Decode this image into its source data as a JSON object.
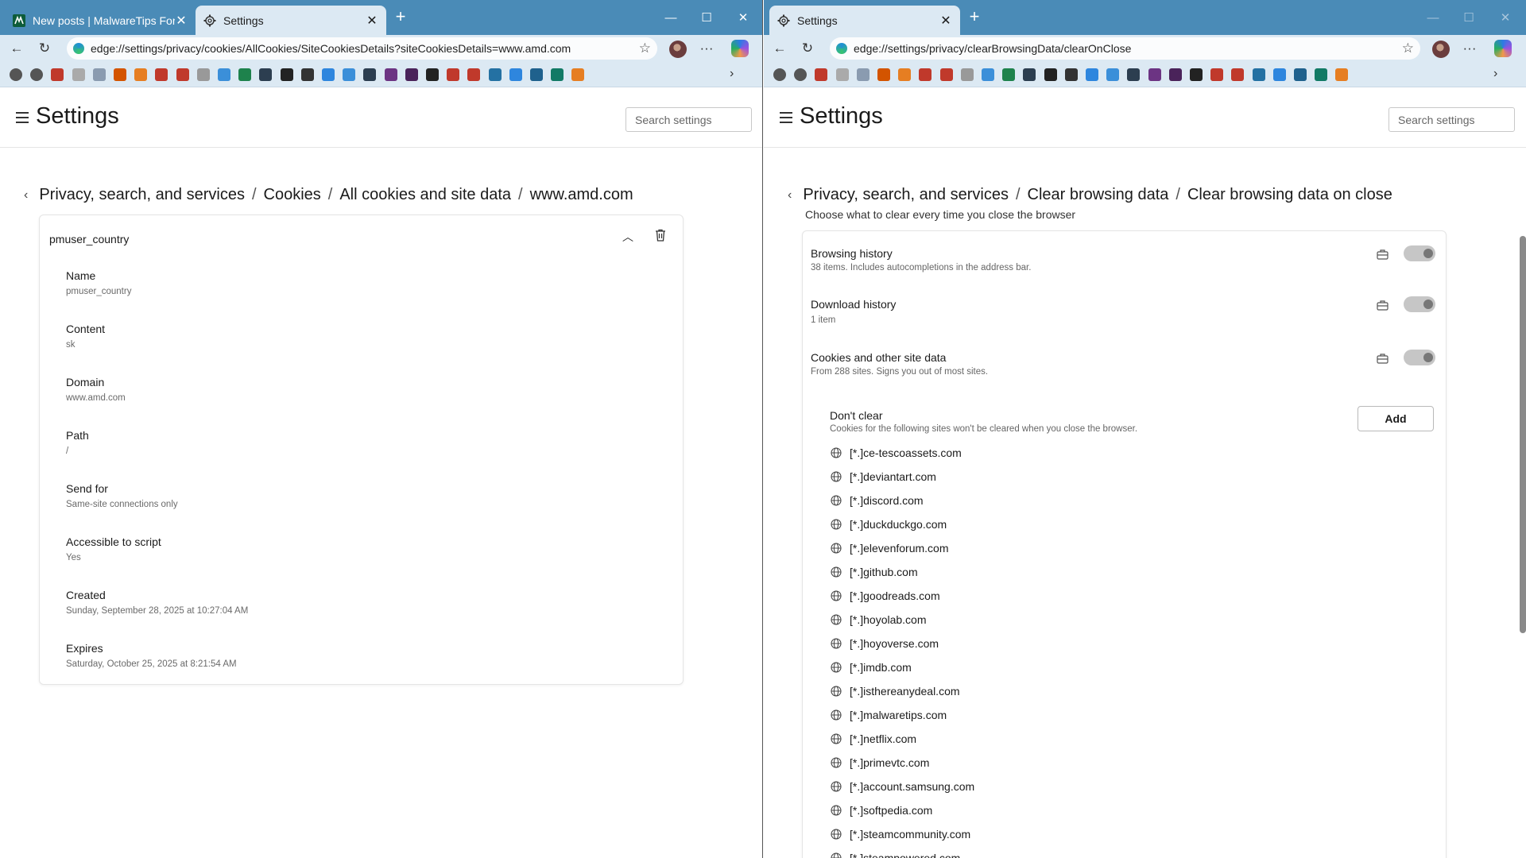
{
  "left": {
    "tabs": [
      {
        "label": "New posts | MalwareTips Forums",
        "active": false
      },
      {
        "label": "Settings",
        "active": true
      }
    ],
    "address": "edge://settings/privacy/cookies/AllCookies/SiteCookiesDetails?siteCookiesDetails=www.amd.com",
    "settings_title": "Settings",
    "search_placeholder": "Search settings",
    "breadcrumb": [
      "Privacy, search, and services",
      "Cookies",
      "All cookies and site data",
      "www.amd.com"
    ],
    "cookie_name": "pmuser_country",
    "properties": [
      {
        "label": "Name",
        "value": "pmuser_country"
      },
      {
        "label": "Content",
        "value": "sk"
      },
      {
        "label": "Domain",
        "value": "www.amd.com"
      },
      {
        "label": "Path",
        "value": "/"
      },
      {
        "label": "Send for",
        "value": "Same-site connections only"
      },
      {
        "label": "Accessible to script",
        "value": "Yes"
      },
      {
        "label": "Created",
        "value": "Sunday, September 28, 2025 at 10:27:04 AM"
      },
      {
        "label": "Expires",
        "value": "Saturday, October 25, 2025 at 8:21:54 AM"
      }
    ]
  },
  "right": {
    "tabs": [
      {
        "label": "Settings",
        "active": true
      }
    ],
    "address": "edge://settings/privacy/clearBrowsingData/clearOnClose",
    "settings_title": "Settings",
    "search_placeholder": "Search settings",
    "breadcrumb": [
      "Privacy, search, and services",
      "Clear browsing data",
      "Clear browsing data on close"
    ],
    "subtitle": "Choose what to clear every time you close the browser",
    "options": [
      {
        "title": "Browsing history",
        "desc": "38 items. Includes autocompletions in the address bar."
      },
      {
        "title": "Download history",
        "desc": "1 item"
      },
      {
        "title": "Cookies and other site data",
        "desc": "From 288 sites. Signs you out of most sites."
      }
    ],
    "dont_clear": {
      "title": "Don't clear",
      "desc": "Cookies for the following sites won't be cleared when you close the browser.",
      "add_label": "Add",
      "sites": [
        "[*.]ce-tescoassets.com",
        "[*.]deviantart.com",
        "[*.]discord.com",
        "[*.]duckduckgo.com",
        "[*.]elevenforum.com",
        "[*.]github.com",
        "[*.]goodreads.com",
        "[*.]hoyolab.com",
        "[*.]hoyoverse.com",
        "[*.]imdb.com",
        "[*.]isthereanydeal.com",
        "[*.]malwaretips.com",
        "[*.]netflix.com",
        "[*.]primevtc.com",
        "[*.]account.samsung.com",
        "[*.]softpedia.com",
        "[*.]steamcommunity.com",
        "[*.]steampowered.com"
      ]
    }
  },
  "colors": {
    "tabstrip": "#4a8bb7",
    "toolbar": "#dce9f3",
    "toggle_off": "#c6c6c6"
  },
  "favorites_icons": [
    "globe-icon",
    "history-icon",
    "pocket-icon",
    "news-icon",
    "reader-icon",
    "h-icon",
    "orange-square-icon",
    "t-red-icon",
    "t-red2-icon",
    "circle-c-icon",
    "blue-circle-icon",
    "w-green-icon",
    "z-icon",
    "a-icon",
    "location-icon",
    "feather-icon",
    "ibb-icon",
    "mal-icon",
    "play-icon",
    "h-dark-icon",
    "dark-circle-icon",
    "red-wave-icon",
    "g2-icon",
    "vk-icon",
    "shield-icon",
    "ws-icon",
    "chart-icon",
    "calendar-icon"
  ]
}
